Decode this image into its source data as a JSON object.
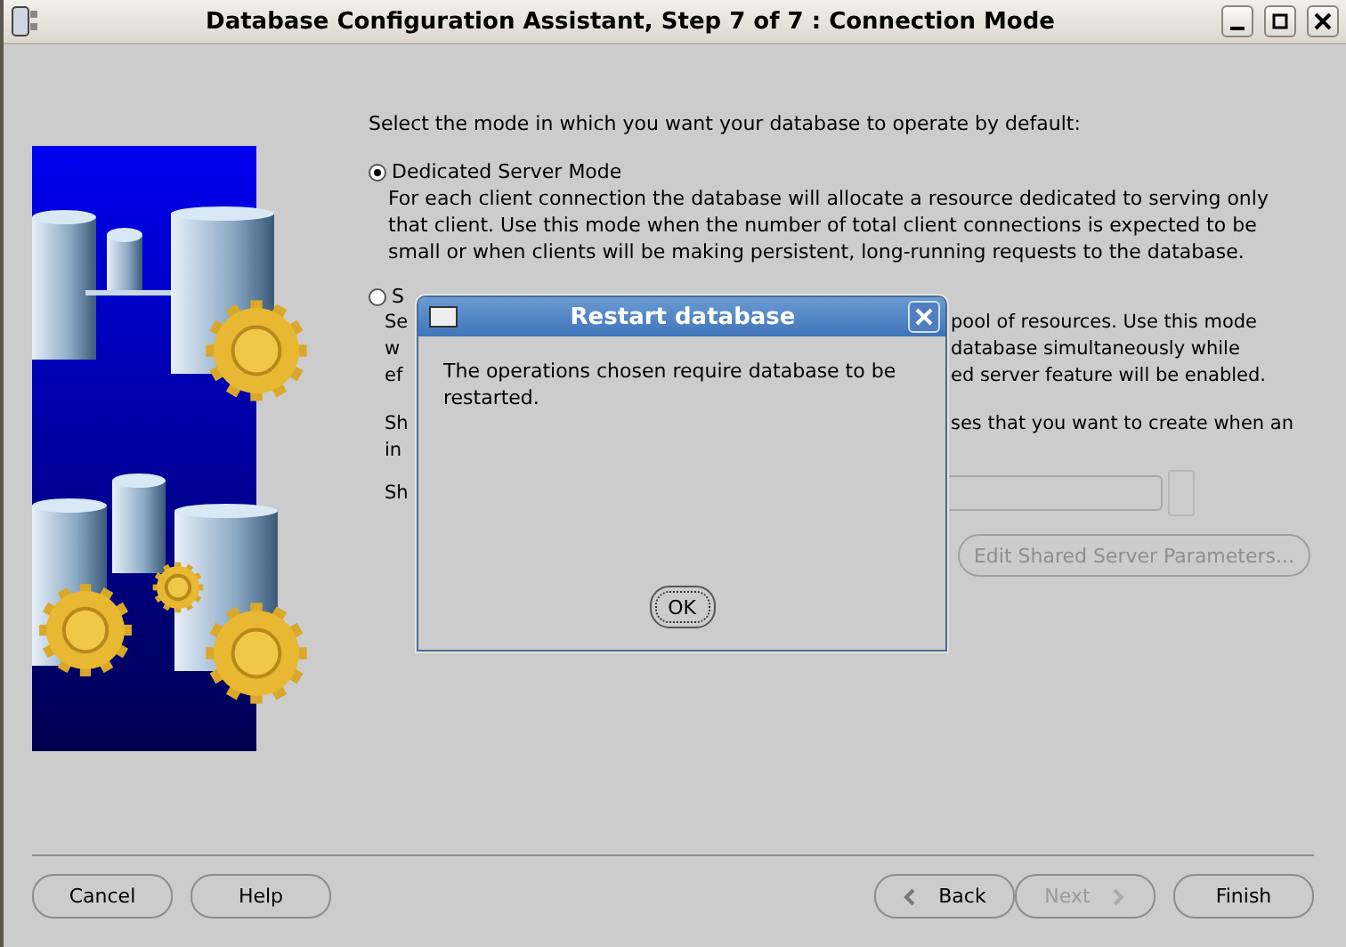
{
  "window": {
    "title": "Database Configuration Assistant, Step 7 of 7 : Connection Mode"
  },
  "intro": "Select the mode in which you want your database to operate by default:",
  "modes": [
    {
      "label": "Dedicated Server Mode",
      "selected": true,
      "description": "For each client connection the database will allocate a resource dedicated to serving only that client.  Use this mode when the number of total client connections is expected to be small or when clients will be making persistent, long-running requests to the database."
    },
    {
      "label": "S",
      "selected": false
    }
  ],
  "shared_fragments": [
    {
      "left": "Se",
      "right": "pool of resources.  Use this mode"
    },
    {
      "left": "w",
      "right": "database simultaneously while"
    },
    {
      "left": "ef",
      "right": "ed server feature will be enabled."
    }
  ],
  "dispatcher_fragments": [
    {
      "left": "Sh",
      "right": "ses that you want to create when an"
    },
    {
      "left": "in"
    }
  ],
  "server_label_fragment": "Sh",
  "spinner": {
    "disabled": true
  },
  "edit_button": {
    "label": "Edit Shared Server Parameters...",
    "disabled": true
  },
  "buttons_left": [
    {
      "label": "Cancel",
      "disabled": false
    },
    {
      "label": "Help",
      "disabled": false
    }
  ],
  "buttons_right": [
    {
      "label": "Back",
      "kind": "back",
      "disabled": false
    },
    {
      "label": "Next",
      "kind": "next",
      "disabled": true
    },
    {
      "label": "Finish",
      "kind": "plain",
      "disabled": false
    }
  ],
  "dialog": {
    "title": "Restart database",
    "message": "The operations chosen require database to be restarted.",
    "button": "OK"
  }
}
